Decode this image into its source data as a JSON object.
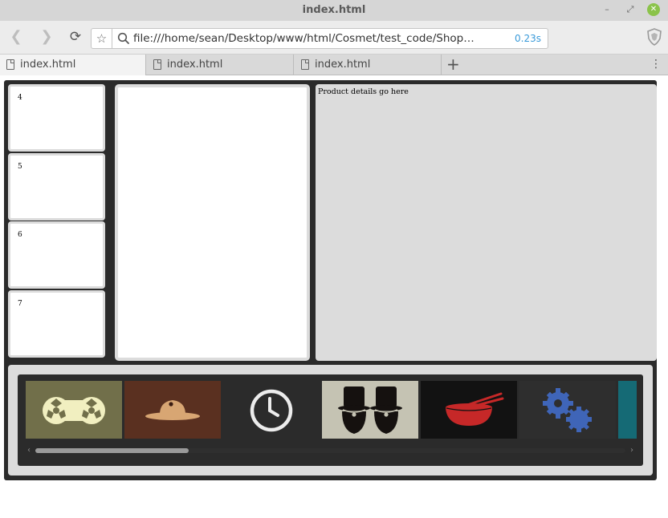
{
  "window": {
    "title": "index.html"
  },
  "toolbar": {
    "url": "file:///home/sean/Desktop/www/html/Cosmet/test_code/Shop_segment/ind...",
    "load_time": "0.23s"
  },
  "tabs": [
    {
      "label": "index.html",
      "active": true
    },
    {
      "label": "index.html",
      "active": false
    },
    {
      "label": "index.html",
      "active": false
    }
  ],
  "thumbnails": [
    {
      "label": "4"
    },
    {
      "label": "5"
    },
    {
      "label": "6"
    },
    {
      "label": "7"
    }
  ],
  "product_details": {
    "text": "Product details go here"
  },
  "carousel": {
    "items": [
      {
        "icon": "reel-tape-icon",
        "bg": "#716f4a"
      },
      {
        "icon": "hat-icon",
        "bg": "#5a3020"
      },
      {
        "icon": "clock-icon",
        "bg": "#2b2b2b"
      },
      {
        "icon": "top-hats-icon",
        "bg": "#c5c3b3"
      },
      {
        "icon": "noodle-bowl-icon",
        "bg": "#121212"
      },
      {
        "icon": "gears-icon",
        "bg": "#2e2e2e"
      },
      {
        "icon": "teal-tile-icon",
        "bg": "#156a75"
      }
    ],
    "scroll_position": 0.26
  },
  "colors": {
    "frame": "#2b2b2b",
    "panel": "#dcdcdc",
    "accent_link": "#3a9ad9",
    "close_button": "#8bc34a"
  }
}
